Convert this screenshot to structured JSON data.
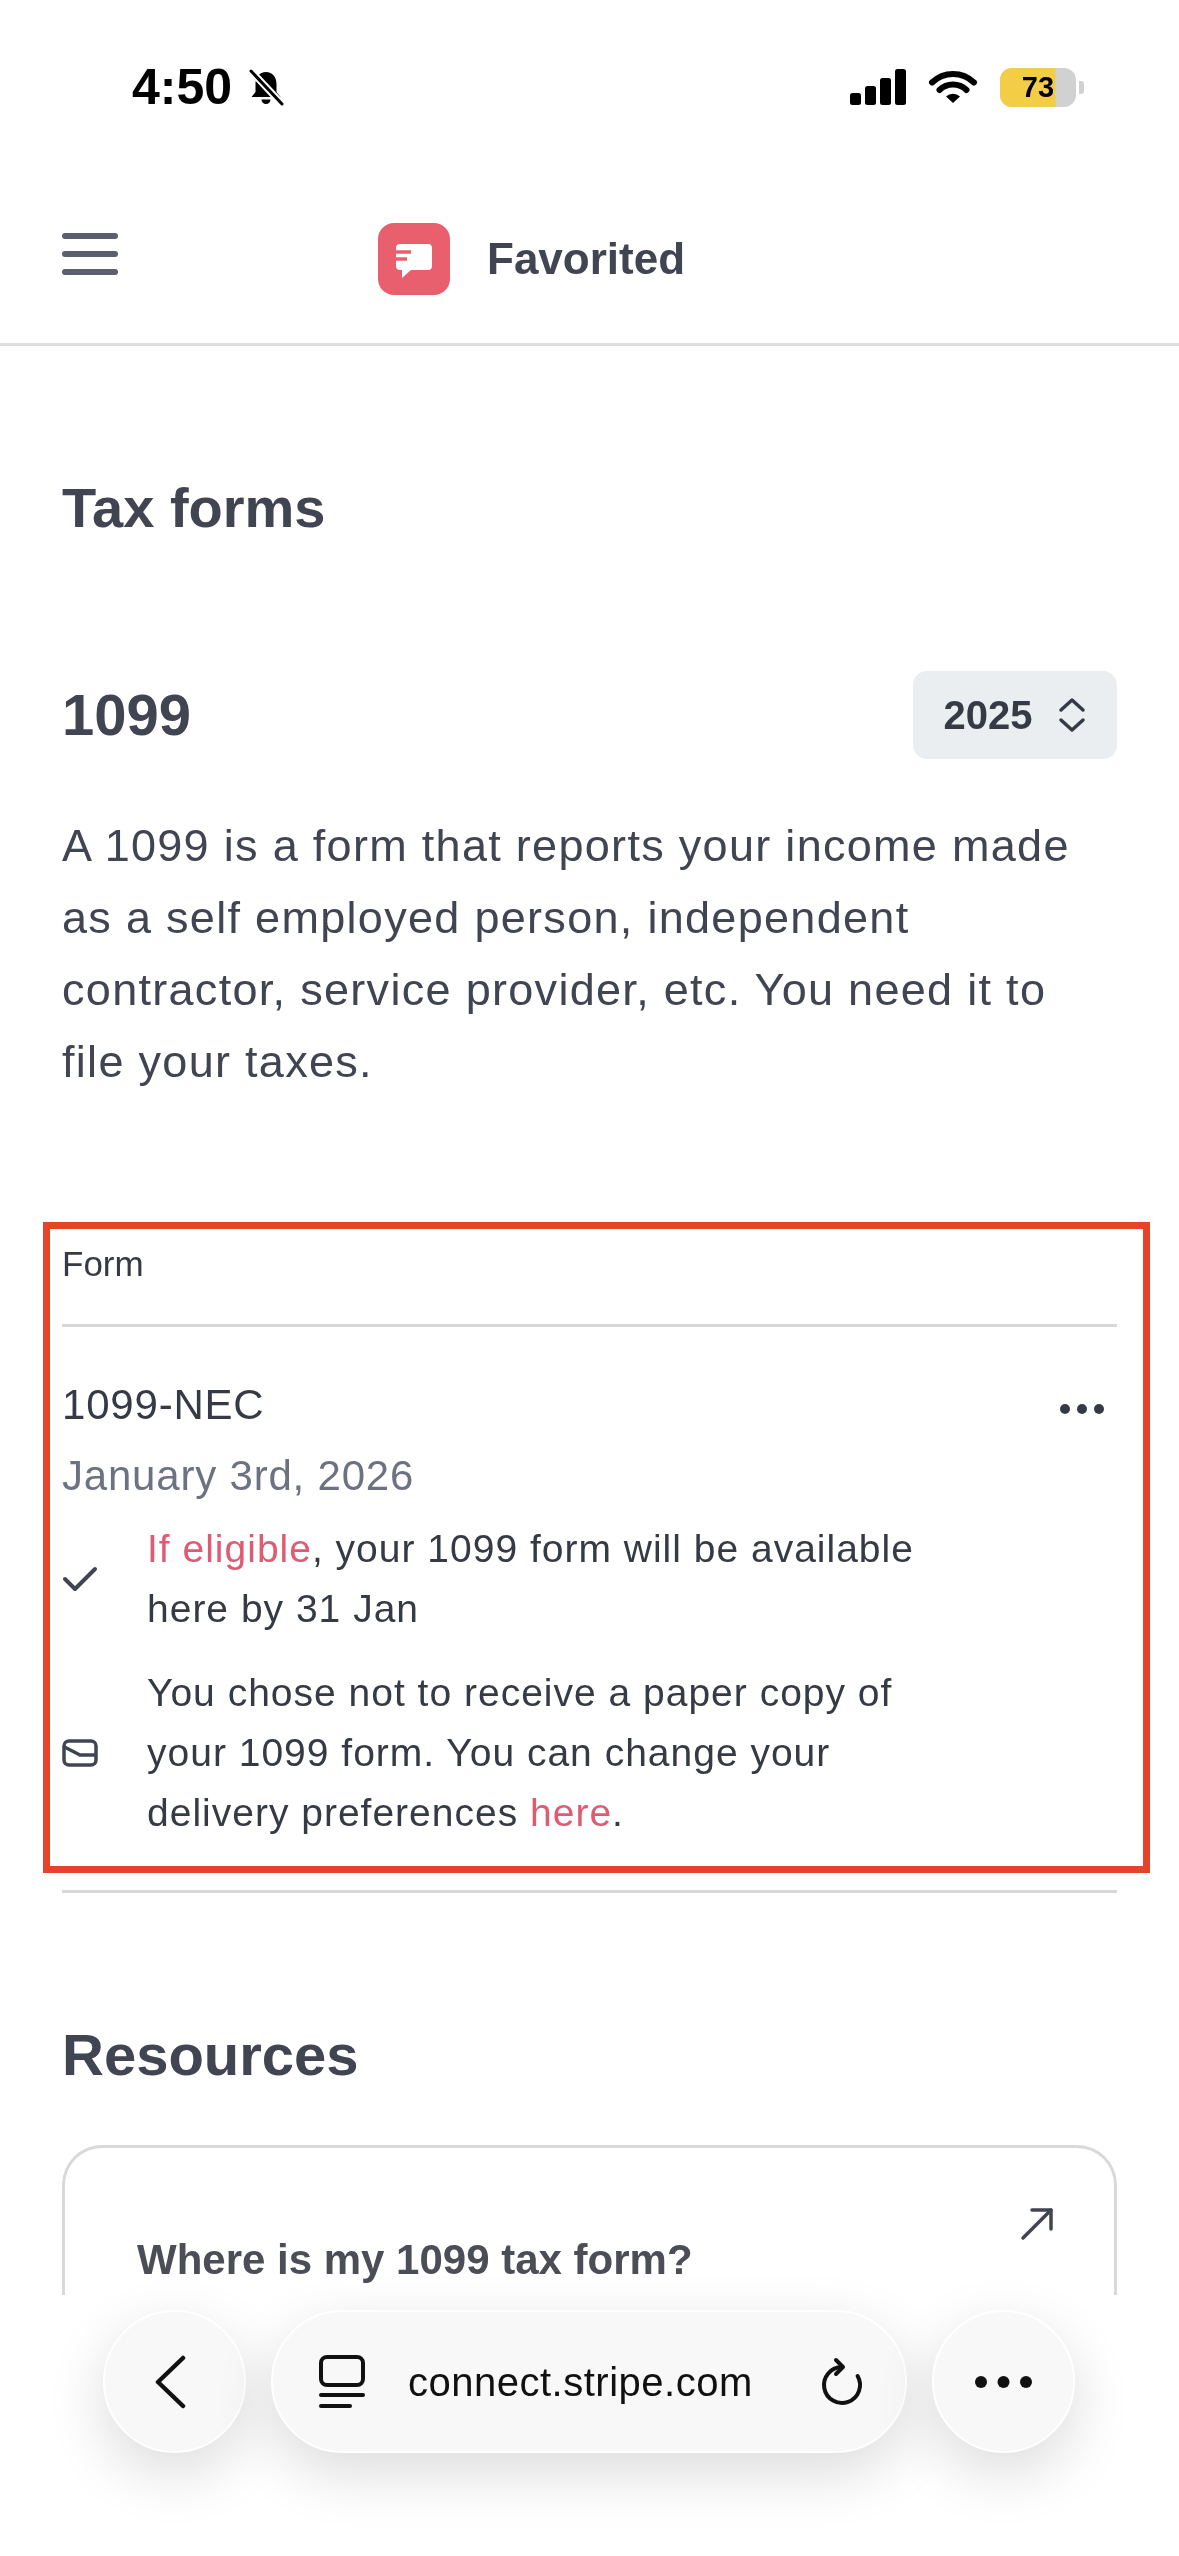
{
  "status_bar": {
    "time": "4:50",
    "silent": true,
    "battery": "73"
  },
  "header": {
    "title": "Favorited"
  },
  "page_title": "Tax forms",
  "section": {
    "title": "1099",
    "year": "2025",
    "description": "A 1099 is a form that reports your income made as a self employed person, independent contractor, service provider, etc. You need it to file your taxes."
  },
  "form_table": {
    "highlighted": true,
    "column": "Form",
    "rows": [
      {
        "name": "1099-NEC",
        "date": "January 3rd, 2026",
        "notes": [
          {
            "kind": "check",
            "segments": [
              {
                "kind": "link",
                "text": "If eligible"
              },
              {
                "kind": "text",
                "text": ", your 1099 form will be available here by 31 Jan"
              }
            ]
          },
          {
            "kind": "mail",
            "segments": [
              {
                "kind": "text",
                "text": "You chose not to receive a paper copy of your 1099 form. You can change your delivery preferences "
              },
              {
                "kind": "link",
                "text": "here"
              },
              {
                "kind": "text",
                "text": "."
              }
            ]
          }
        ]
      }
    ]
  },
  "resources": {
    "title": "Resources",
    "cards": [
      {
        "title": "Where is my 1099 tax form?"
      }
    ]
  },
  "browser_bar": {
    "url": "connect.stripe.com"
  }
}
